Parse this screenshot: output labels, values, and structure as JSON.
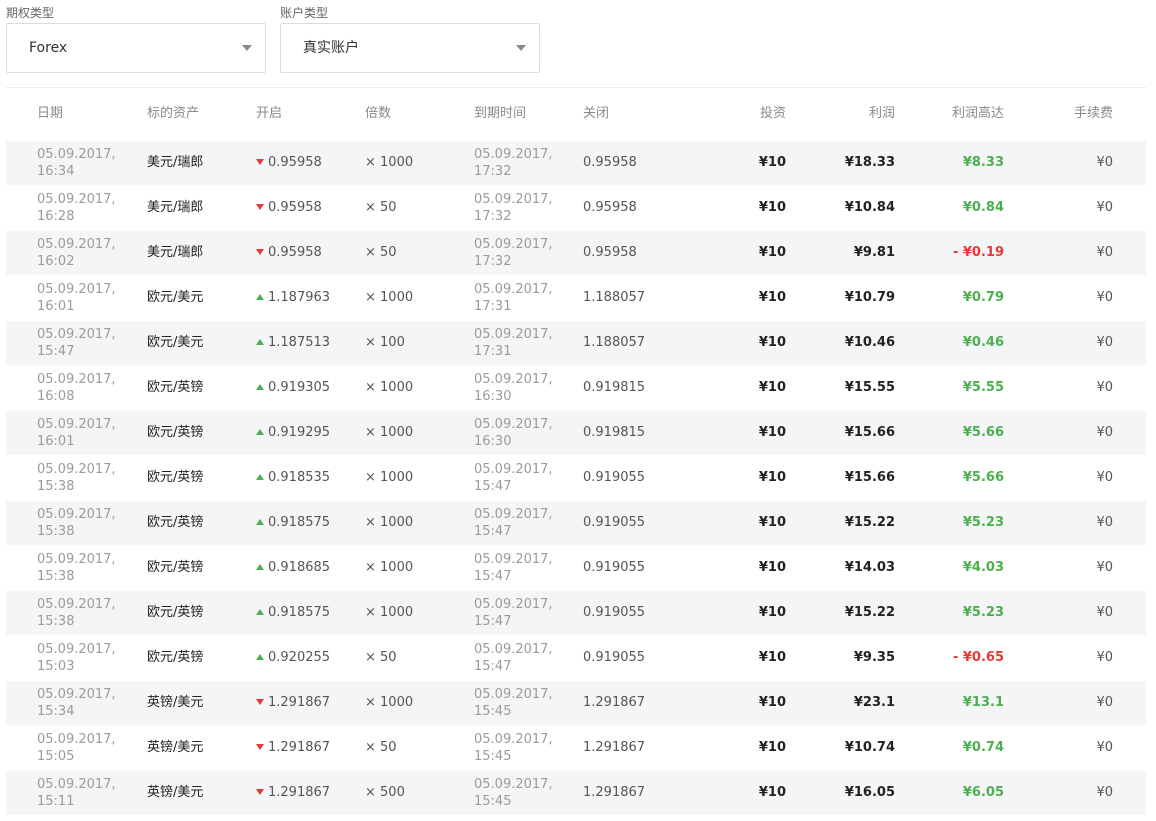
{
  "filters": {
    "option_type": {
      "label": "期权类型",
      "value": "Forex"
    },
    "account_type": {
      "label": "账户类型",
      "value": "真实账户"
    }
  },
  "table": {
    "columns": {
      "date": "日期",
      "asset": "标的资产",
      "open": "开启",
      "multiplier": "倍数",
      "expiry": "到期时间",
      "close": "关闭",
      "investment": "投资",
      "profit": "利润",
      "profit_up_to": "利润高达",
      "fee": "手续费"
    },
    "rows": [
      {
        "date1": "05.09.2017,",
        "date2": "16:34",
        "asset": "美元/瑞郎",
        "direction": "down",
        "open": "0.95958",
        "multiplier": "× 1000",
        "exp1": "05.09.2017,",
        "exp2": "17:32",
        "close": "0.95958",
        "investment": "¥10",
        "profit": "¥18.33",
        "upto": "¥8.33",
        "upto_sign": "pos",
        "fee": "¥0"
      },
      {
        "date1": "05.09.2017,",
        "date2": "16:28",
        "asset": "美元/瑞郎",
        "direction": "down",
        "open": "0.95958",
        "multiplier": "× 50",
        "exp1": "05.09.2017,",
        "exp2": "17:32",
        "close": "0.95958",
        "investment": "¥10",
        "profit": "¥10.84",
        "upto": "¥0.84",
        "upto_sign": "pos",
        "fee": "¥0"
      },
      {
        "date1": "05.09.2017,",
        "date2": "16:02",
        "asset": "美元/瑞郎",
        "direction": "down",
        "open": "0.95958",
        "multiplier": "× 50",
        "exp1": "05.09.2017,",
        "exp2": "17:32",
        "close": "0.95958",
        "investment": "¥10",
        "profit": "¥9.81",
        "upto": "- ¥0.19",
        "upto_sign": "neg",
        "fee": "¥0"
      },
      {
        "date1": "05.09.2017,",
        "date2": "16:01",
        "asset": "欧元/美元",
        "direction": "up",
        "open": "1.187963",
        "multiplier": "× 1000",
        "exp1": "05.09.2017,",
        "exp2": "17:31",
        "close": "1.188057",
        "investment": "¥10",
        "profit": "¥10.79",
        "upto": "¥0.79",
        "upto_sign": "pos",
        "fee": "¥0"
      },
      {
        "date1": "05.09.2017,",
        "date2": "15:47",
        "asset": "欧元/美元",
        "direction": "up",
        "open": "1.187513",
        "multiplier": "× 100",
        "exp1": "05.09.2017,",
        "exp2": "17:31",
        "close": "1.188057",
        "investment": "¥10",
        "profit": "¥10.46",
        "upto": "¥0.46",
        "upto_sign": "pos",
        "fee": "¥0"
      },
      {
        "date1": "05.09.2017,",
        "date2": "16:08",
        "asset": "欧元/英镑",
        "direction": "up",
        "open": "0.919305",
        "multiplier": "× 1000",
        "exp1": "05.09.2017,",
        "exp2": "16:30",
        "close": "0.919815",
        "investment": "¥10",
        "profit": "¥15.55",
        "upto": "¥5.55",
        "upto_sign": "pos",
        "fee": "¥0"
      },
      {
        "date1": "05.09.2017,",
        "date2": "16:01",
        "asset": "欧元/英镑",
        "direction": "up",
        "open": "0.919295",
        "multiplier": "× 1000",
        "exp1": "05.09.2017,",
        "exp2": "16:30",
        "close": "0.919815",
        "investment": "¥10",
        "profit": "¥15.66",
        "upto": "¥5.66",
        "upto_sign": "pos",
        "fee": "¥0"
      },
      {
        "date1": "05.09.2017,",
        "date2": "15:38",
        "asset": "欧元/英镑",
        "direction": "up",
        "open": "0.918535",
        "multiplier": "× 1000",
        "exp1": "05.09.2017,",
        "exp2": "15:47",
        "close": "0.919055",
        "investment": "¥10",
        "profit": "¥15.66",
        "upto": "¥5.66",
        "upto_sign": "pos",
        "fee": "¥0"
      },
      {
        "date1": "05.09.2017,",
        "date2": "15:38",
        "asset": "欧元/英镑",
        "direction": "up",
        "open": "0.918575",
        "multiplier": "× 1000",
        "exp1": "05.09.2017,",
        "exp2": "15:47",
        "close": "0.919055",
        "investment": "¥10",
        "profit": "¥15.22",
        "upto": "¥5.23",
        "upto_sign": "pos",
        "fee": "¥0"
      },
      {
        "date1": "05.09.2017,",
        "date2": "15:38",
        "asset": "欧元/英镑",
        "direction": "up",
        "open": "0.918685",
        "multiplier": "× 1000",
        "exp1": "05.09.2017,",
        "exp2": "15:47",
        "close": "0.919055",
        "investment": "¥10",
        "profit": "¥14.03",
        "upto": "¥4.03",
        "upto_sign": "pos",
        "fee": "¥0"
      },
      {
        "date1": "05.09.2017,",
        "date2": "15:38",
        "asset": "欧元/英镑",
        "direction": "up",
        "open": "0.918575",
        "multiplier": "× 1000",
        "exp1": "05.09.2017,",
        "exp2": "15:47",
        "close": "0.919055",
        "investment": "¥10",
        "profit": "¥15.22",
        "upto": "¥5.23",
        "upto_sign": "pos",
        "fee": "¥0"
      },
      {
        "date1": "05.09.2017,",
        "date2": "15:03",
        "asset": "欧元/英镑",
        "direction": "up",
        "open": "0.920255",
        "multiplier": "× 50",
        "exp1": "05.09.2017,",
        "exp2": "15:47",
        "close": "0.919055",
        "investment": "¥10",
        "profit": "¥9.35",
        "upto": "- ¥0.65",
        "upto_sign": "neg",
        "fee": "¥0"
      },
      {
        "date1": "05.09.2017,",
        "date2": "15:34",
        "asset": "英镑/美元",
        "direction": "down",
        "open": "1.291867",
        "multiplier": "× 1000",
        "exp1": "05.09.2017,",
        "exp2": "15:45",
        "close": "1.291867",
        "investment": "¥10",
        "profit": "¥23.1",
        "upto": "¥13.1",
        "upto_sign": "pos",
        "fee": "¥0"
      },
      {
        "date1": "05.09.2017,",
        "date2": "15:05",
        "asset": "英镑/美元",
        "direction": "down",
        "open": "1.291867",
        "multiplier": "× 50",
        "exp1": "05.09.2017,",
        "exp2": "15:45",
        "close": "1.291867",
        "investment": "¥10",
        "profit": "¥10.74",
        "upto": "¥0.74",
        "upto_sign": "pos",
        "fee": "¥0"
      },
      {
        "date1": "05.09.2017,",
        "date2": "15:11",
        "asset": "英镑/美元",
        "direction": "down",
        "open": "1.291867",
        "multiplier": "× 500",
        "exp1": "05.09.2017,",
        "exp2": "15:45",
        "close": "1.291867",
        "investment": "¥10",
        "profit": "¥16.05",
        "upto": "¥6.05",
        "upto_sign": "pos",
        "fee": "¥0"
      }
    ]
  }
}
